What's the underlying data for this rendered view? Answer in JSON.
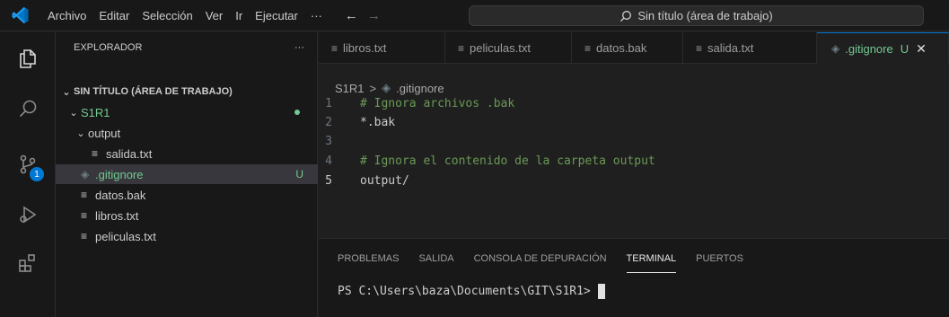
{
  "titlebar": {
    "menu": [
      "Archivo",
      "Editar",
      "Selección",
      "Ver",
      "Ir",
      "Ejecutar",
      "···"
    ],
    "search_text": "Sin título (área de trabajo)",
    "back_arrow": "←",
    "forward_arrow": "→"
  },
  "activity": {
    "icons": [
      "explorer-icon",
      "search-icon",
      "source-control-icon",
      "run-debug-icon",
      "extensions-icon"
    ],
    "scm_badge": "1"
  },
  "sidebar": {
    "title": "EXPLORADOR",
    "more": "···",
    "workspace": "SIN TÍTULO (ÁREA DE TRABAJO)",
    "folder": "S1R1",
    "subfolder": "output",
    "items": [
      {
        "label": "salida.txt"
      },
      {
        "label": ".gitignore",
        "status": "U"
      },
      {
        "label": "datos.bak"
      },
      {
        "label": "libros.txt"
      },
      {
        "label": "peliculas.txt"
      }
    ]
  },
  "tabs": [
    {
      "label": "libros.txt"
    },
    {
      "label": "peliculas.txt"
    },
    {
      "label": "datos.bak"
    },
    {
      "label": "salida.txt"
    },
    {
      "label": ".gitignore",
      "status": "U",
      "close": "✕"
    }
  ],
  "breadcrumb": {
    "folder": "S1R1",
    "sep": ">",
    "file": ".gitignore"
  },
  "editor": {
    "lines": [
      {
        "num": "1",
        "text": "# Ignora archivos .bak"
      },
      {
        "num": "2",
        "text": "*.bak"
      },
      {
        "num": "3",
        "text": ""
      },
      {
        "num": "4",
        "text": "# Ignora el contenido de la carpeta output"
      },
      {
        "num": "5",
        "text": "output/"
      }
    ]
  },
  "panel": {
    "tabs": [
      "PROBLEMAS",
      "SALIDA",
      "CONSOLA DE DEPURACIÓN",
      "TERMINAL",
      "PUERTOS"
    ],
    "active_tab": "TERMINAL",
    "prompt": "PS C:\\Users\\baza\\Documents\\GIT\\S1R1>"
  },
  "colors": {
    "accent": "#0078d4",
    "git_untracked": "#73c991",
    "comment": "#6a9955"
  }
}
